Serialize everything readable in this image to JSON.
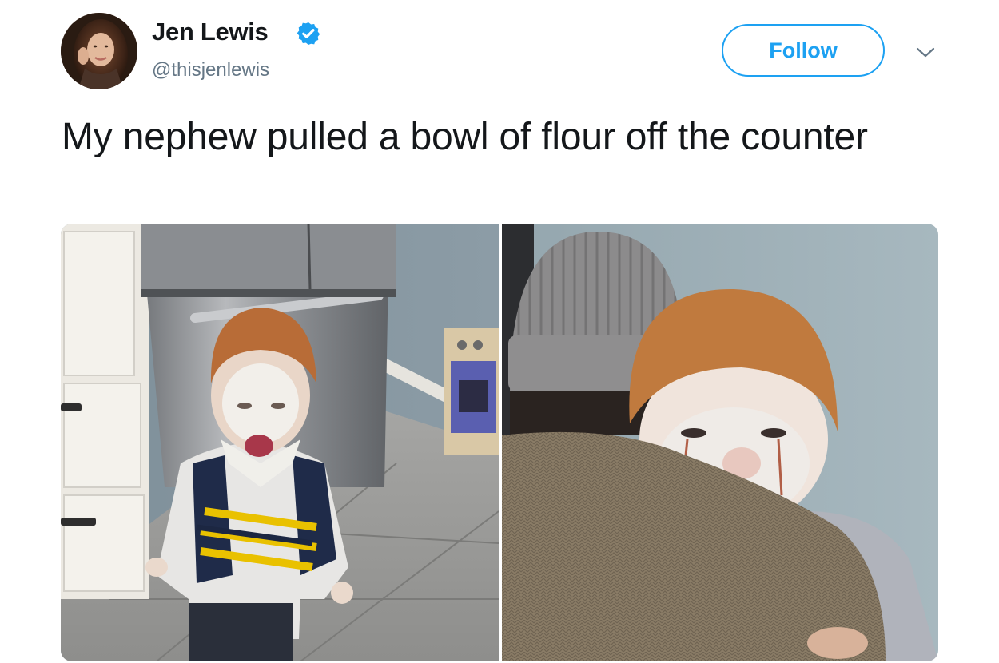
{
  "tweet": {
    "author": {
      "display_name": "Jen Lewis",
      "handle": "@thisjenlewis",
      "verified": true,
      "avatar_icon": "user-avatar-photo"
    },
    "follow_label": "Follow",
    "more_icon": "chevron-down-icon",
    "text": "My nephew pulled a bowl of flour off the counter",
    "media": [
      {
        "name": "photo-toddler-kitchen"
      },
      {
        "name": "photo-toddler-hugged"
      }
    ]
  },
  "colors": {
    "accent": "#1da1f2",
    "text": "#14171a",
    "secondary_text": "#657786"
  }
}
